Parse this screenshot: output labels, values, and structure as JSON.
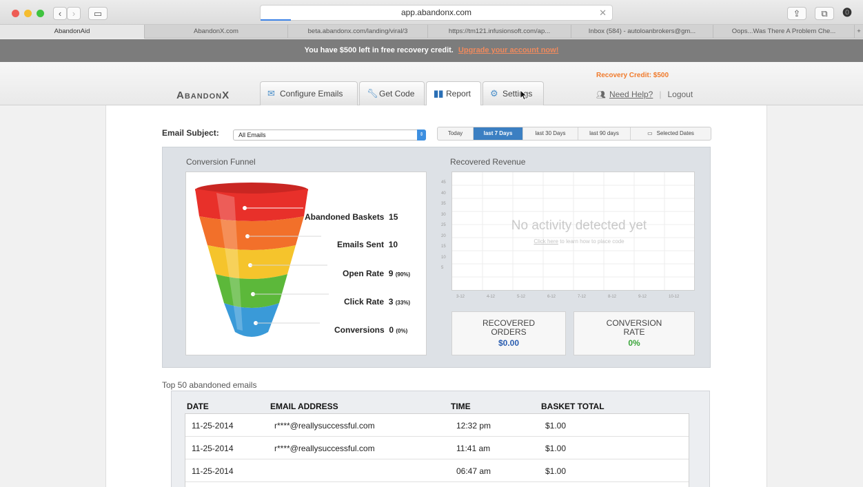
{
  "browser": {
    "url": "app.abandonx.com",
    "tabs": [
      "AbandonAid",
      "AbandonX.com",
      "beta.abandonx.com/landing/viral/3",
      "https://tm121.infusionsoft.com/ap...",
      "Inbox (584) - autoloanbrokers@gm...",
      "Oops...Was There A Problem Che..."
    ]
  },
  "banner": {
    "text": "You have $500 left in free recovery credit.",
    "link": "Upgrade your account now!"
  },
  "header": {
    "logo": "AbandonX",
    "tabs": [
      {
        "label": "Configure Emails",
        "icon": "envelope-icon"
      },
      {
        "label": "Get Code",
        "icon": "wrench-icon"
      },
      {
        "label": "Report",
        "icon": "bar-chart-icon"
      },
      {
        "label": "Settings",
        "icon": "gear-icon"
      }
    ],
    "recovery_credit": "Recovery Credit: $500",
    "help": "Need Help?",
    "logout": "Logout"
  },
  "filters": {
    "subject_label": "Email Subject:",
    "subject_value": "All Emails",
    "ranges": [
      "Today",
      "last 7 Days",
      "last 30 Days",
      "last 90 days",
      "Selected Dates"
    ],
    "selected_range": "last 7 Days"
  },
  "funnel": {
    "title": "Conversion Funnel",
    "stages": [
      {
        "label": "Abandoned Baskets",
        "value": "15",
        "pct": ""
      },
      {
        "label": "Emails Sent",
        "value": "10",
        "pct": ""
      },
      {
        "label": "Open Rate",
        "value": "9",
        "pct": "(90%)"
      },
      {
        "label": "Click Rate",
        "value": "3",
        "pct": "(33%)"
      },
      {
        "label": "Conversions",
        "value": "0",
        "pct": "(0%)"
      }
    ],
    "colors": [
      "#e8302a",
      "#f2702a",
      "#f5c42c",
      "#5cb83a",
      "#3a9ad8"
    ]
  },
  "revenue": {
    "title": "Recovered Revenue",
    "empty_title": "No activity detected yet",
    "empty_link": "Click here",
    "empty_sub": "to learn how to place code",
    "yticks": [
      "45",
      "40",
      "35",
      "30",
      "25",
      "20",
      "15",
      "10",
      "5"
    ],
    "xticks": [
      "3-12",
      "4-12",
      "5-12",
      "6-12",
      "7-12",
      "8-12",
      "9-12",
      "10-12"
    ]
  },
  "stats": {
    "orders_label_1": "RECOVERED",
    "orders_label_2": "ORDERS",
    "orders_value": "$0.00",
    "rate_label_1": "CONVERSION",
    "rate_label_2": "RATE",
    "rate_value": "0%"
  },
  "table": {
    "title": "Top 50 abandoned emails",
    "columns": [
      "DATE",
      "EMAIL ADDRESS",
      "TIME",
      "BASKET TOTAL"
    ],
    "rows": [
      [
        "11-25-2014",
        "r****@reallysuccessful.com",
        "12:32 pm",
        "$1.00"
      ],
      [
        "11-25-2014",
        "r****@reallysuccessful.com",
        "11:41 am",
        "$1.00"
      ],
      [
        "11-25-2014",
        "",
        "06:47 am",
        "$1.00"
      ]
    ]
  }
}
